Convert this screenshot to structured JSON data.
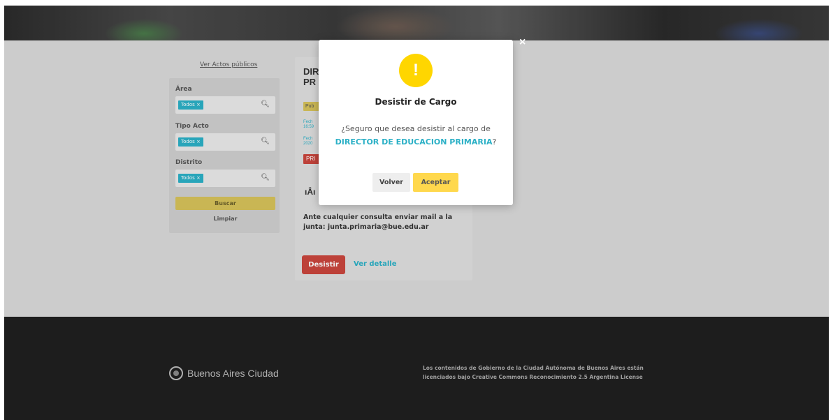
{
  "filters": {
    "ver_actos": "Ver Actos públicos",
    "area_label": "Área",
    "tipo_acto_label": "Tipo Acto",
    "distrito_label": "Distrito",
    "tag_todos": "Todos ×",
    "buscar": "Buscar",
    "limpiar": "Limpiar"
  },
  "card": {
    "title_line1": "DIR",
    "title_line2": "PR",
    "badge_pub": "Pub",
    "fecha1_line1": "Fech",
    "fecha1_line2": "16:59",
    "fecha2_line1": "Fech",
    "fecha2_line2": "2020",
    "badge_red": "PRI",
    "icon_text": "ıÂı",
    "consulta": "Ante cualquier consulta enviar mail a la junta: junta.primaria@bue.edu.ar",
    "desistir": "Desistir",
    "ver_detalle": "Ver detalle"
  },
  "modal": {
    "icon": "!",
    "title": "Desistir de Cargo",
    "message_prefix": "¿Seguro que desea desistir al cargo de",
    "cargo": "DIRECTOR DE EDUCACION PRIMARIA",
    "message_suffix": "?",
    "volver": "Volver",
    "aceptar": "Aceptar",
    "close": "×"
  },
  "footer": {
    "logo_text": "Buenos Aires Ciudad",
    "note_line1": "Los contenidos de Gobierno de la Ciudad Autónoma de Buenos Aires están",
    "note_line2": "licenciados bajo Creative Commons Reconocimiento 2.5 Argentina License"
  },
  "colors": {
    "accent": "#2bb0c6",
    "warning": "#ffd600",
    "danger": "#c9463d",
    "footer_bg": "#1f1f1f"
  }
}
